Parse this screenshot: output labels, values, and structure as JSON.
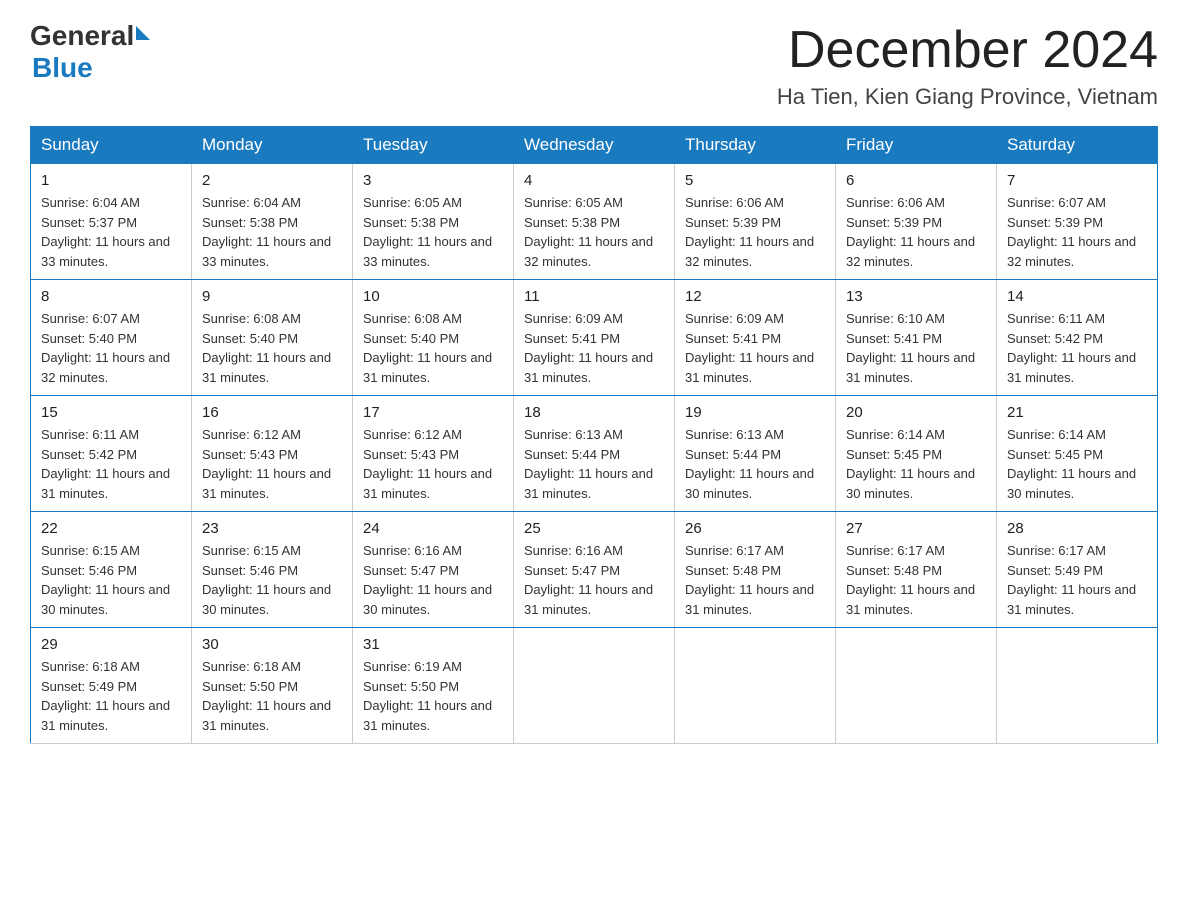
{
  "header": {
    "logo_general": "General",
    "logo_blue": "Blue",
    "month_title": "December 2024",
    "location": "Ha Tien, Kien Giang Province, Vietnam"
  },
  "days_of_week": [
    "Sunday",
    "Monday",
    "Tuesday",
    "Wednesday",
    "Thursday",
    "Friday",
    "Saturday"
  ],
  "weeks": [
    [
      {
        "day": "1",
        "sunrise": "6:04 AM",
        "sunset": "5:37 PM",
        "daylight": "11 hours and 33 minutes."
      },
      {
        "day": "2",
        "sunrise": "6:04 AM",
        "sunset": "5:38 PM",
        "daylight": "11 hours and 33 minutes."
      },
      {
        "day": "3",
        "sunrise": "6:05 AM",
        "sunset": "5:38 PM",
        "daylight": "11 hours and 33 minutes."
      },
      {
        "day": "4",
        "sunrise": "6:05 AM",
        "sunset": "5:38 PM",
        "daylight": "11 hours and 32 minutes."
      },
      {
        "day": "5",
        "sunrise": "6:06 AM",
        "sunset": "5:39 PM",
        "daylight": "11 hours and 32 minutes."
      },
      {
        "day": "6",
        "sunrise": "6:06 AM",
        "sunset": "5:39 PM",
        "daylight": "11 hours and 32 minutes."
      },
      {
        "day": "7",
        "sunrise": "6:07 AM",
        "sunset": "5:39 PM",
        "daylight": "11 hours and 32 minutes."
      }
    ],
    [
      {
        "day": "8",
        "sunrise": "6:07 AM",
        "sunset": "5:40 PM",
        "daylight": "11 hours and 32 minutes."
      },
      {
        "day": "9",
        "sunrise": "6:08 AM",
        "sunset": "5:40 PM",
        "daylight": "11 hours and 31 minutes."
      },
      {
        "day": "10",
        "sunrise": "6:08 AM",
        "sunset": "5:40 PM",
        "daylight": "11 hours and 31 minutes."
      },
      {
        "day": "11",
        "sunrise": "6:09 AM",
        "sunset": "5:41 PM",
        "daylight": "11 hours and 31 minutes."
      },
      {
        "day": "12",
        "sunrise": "6:09 AM",
        "sunset": "5:41 PM",
        "daylight": "11 hours and 31 minutes."
      },
      {
        "day": "13",
        "sunrise": "6:10 AM",
        "sunset": "5:41 PM",
        "daylight": "11 hours and 31 minutes."
      },
      {
        "day": "14",
        "sunrise": "6:11 AM",
        "sunset": "5:42 PM",
        "daylight": "11 hours and 31 minutes."
      }
    ],
    [
      {
        "day": "15",
        "sunrise": "6:11 AM",
        "sunset": "5:42 PM",
        "daylight": "11 hours and 31 minutes."
      },
      {
        "day": "16",
        "sunrise": "6:12 AM",
        "sunset": "5:43 PM",
        "daylight": "11 hours and 31 minutes."
      },
      {
        "day": "17",
        "sunrise": "6:12 AM",
        "sunset": "5:43 PM",
        "daylight": "11 hours and 31 minutes."
      },
      {
        "day": "18",
        "sunrise": "6:13 AM",
        "sunset": "5:44 PM",
        "daylight": "11 hours and 31 minutes."
      },
      {
        "day": "19",
        "sunrise": "6:13 AM",
        "sunset": "5:44 PM",
        "daylight": "11 hours and 30 minutes."
      },
      {
        "day": "20",
        "sunrise": "6:14 AM",
        "sunset": "5:45 PM",
        "daylight": "11 hours and 30 minutes."
      },
      {
        "day": "21",
        "sunrise": "6:14 AM",
        "sunset": "5:45 PM",
        "daylight": "11 hours and 30 minutes."
      }
    ],
    [
      {
        "day": "22",
        "sunrise": "6:15 AM",
        "sunset": "5:46 PM",
        "daylight": "11 hours and 30 minutes."
      },
      {
        "day": "23",
        "sunrise": "6:15 AM",
        "sunset": "5:46 PM",
        "daylight": "11 hours and 30 minutes."
      },
      {
        "day": "24",
        "sunrise": "6:16 AM",
        "sunset": "5:47 PM",
        "daylight": "11 hours and 30 minutes."
      },
      {
        "day": "25",
        "sunrise": "6:16 AM",
        "sunset": "5:47 PM",
        "daylight": "11 hours and 31 minutes."
      },
      {
        "day": "26",
        "sunrise": "6:17 AM",
        "sunset": "5:48 PM",
        "daylight": "11 hours and 31 minutes."
      },
      {
        "day": "27",
        "sunrise": "6:17 AM",
        "sunset": "5:48 PM",
        "daylight": "11 hours and 31 minutes."
      },
      {
        "day": "28",
        "sunrise": "6:17 AM",
        "sunset": "5:49 PM",
        "daylight": "11 hours and 31 minutes."
      }
    ],
    [
      {
        "day": "29",
        "sunrise": "6:18 AM",
        "sunset": "5:49 PM",
        "daylight": "11 hours and 31 minutes."
      },
      {
        "day": "30",
        "sunrise": "6:18 AM",
        "sunset": "5:50 PM",
        "daylight": "11 hours and 31 minutes."
      },
      {
        "day": "31",
        "sunrise": "6:19 AM",
        "sunset": "5:50 PM",
        "daylight": "11 hours and 31 minutes."
      },
      null,
      null,
      null,
      null
    ]
  ],
  "labels": {
    "sunrise": "Sunrise:",
    "sunset": "Sunset:",
    "daylight": "Daylight:"
  }
}
